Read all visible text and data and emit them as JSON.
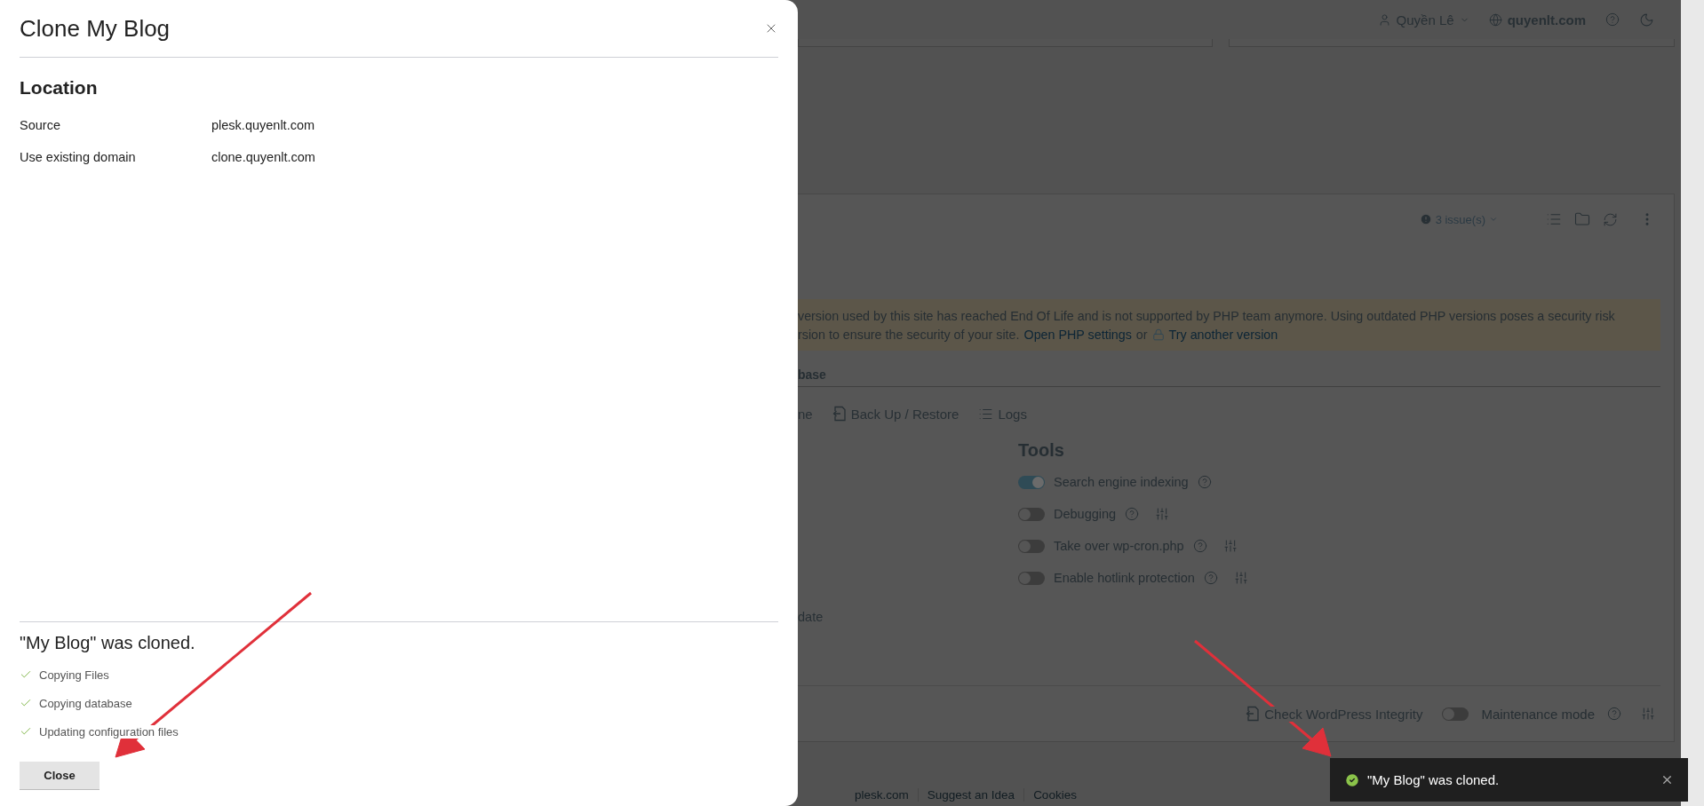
{
  "dialog": {
    "title": "Clone My Blog",
    "section": "Location",
    "fields": [
      {
        "label": "Source",
        "value": "plesk.quyenlt.com"
      },
      {
        "label": "Use existing domain",
        "value": "clone.quyenlt.com"
      }
    ],
    "result": {
      "title": "\"My Blog\" was cloned.",
      "steps": [
        {
          "label": "Copying Files",
          "done": true
        },
        {
          "label": "Copying database",
          "done": true
        },
        {
          "label": "Updating configuration files",
          "done": true
        }
      ]
    },
    "close_button": "Close"
  },
  "header": {
    "user": "Quyền Lê",
    "domain": "quyenlt.com"
  },
  "site_card": {
    "issues": "3 issue(s)",
    "warning": {
      "line_1": "version used by this site has reached End Of Life and is not supported by PHP team anymore. Using outdated PHP versions poses a security risk",
      "line_2": "rsion to ensure the security of your site.",
      "link_1": "Open PHP settings",
      "joiner": "or",
      "link_2": "Try another version"
    },
    "tab": "base",
    "actions": [
      {
        "kind": "plain",
        "label": "ne"
      },
      {
        "kind": "backup",
        "label": "Back Up / Restore"
      },
      {
        "kind": "logs",
        "label": "Logs"
      }
    ],
    "tools": {
      "title": "Tools",
      "items": [
        {
          "label": "Search engine indexing",
          "on": true,
          "kind": "plain"
        },
        {
          "label": "Debugging",
          "on": false,
          "kind": "configurable"
        },
        {
          "label": "Take over wp-cron.php",
          "on": false,
          "kind": "configurable"
        },
        {
          "label": "Enable hotlink protection",
          "on": false,
          "kind": "configurable"
        }
      ]
    },
    "left_text": "date",
    "bottom": {
      "integrity": "Check WordPress Integrity",
      "maintenance": {
        "label": "Maintenance mode",
        "on": false
      }
    }
  },
  "footer": [
    "plesk.com",
    "Suggest an Idea",
    "Cookies"
  ],
  "toast": {
    "message": "\"My Blog\" was cloned."
  }
}
